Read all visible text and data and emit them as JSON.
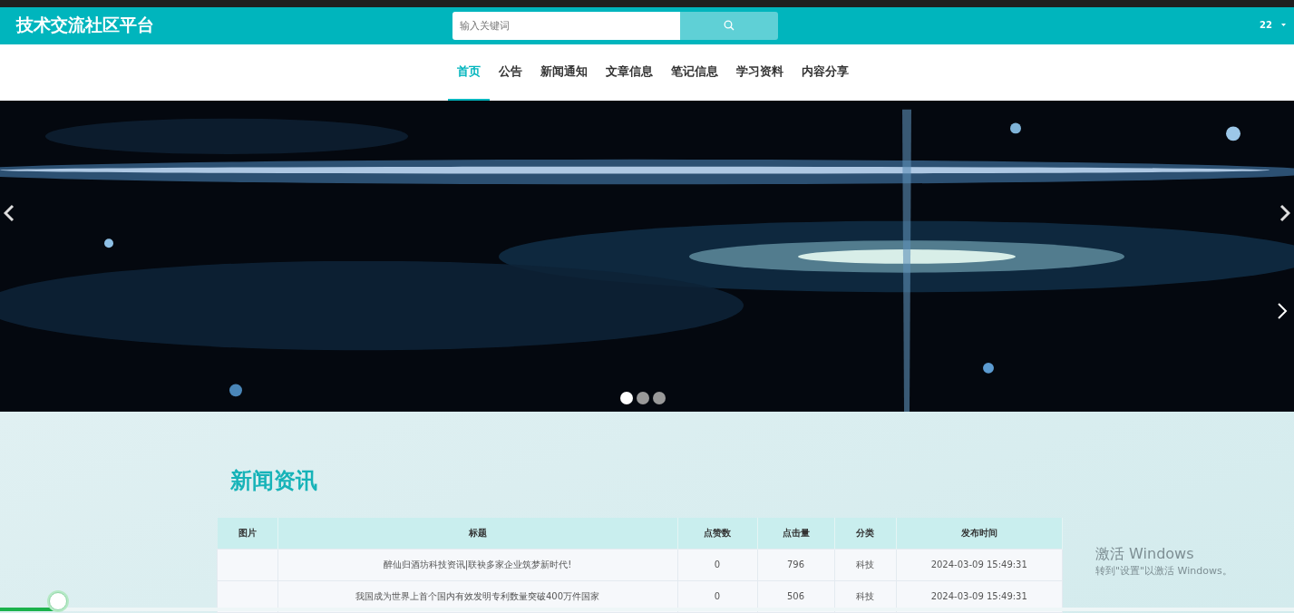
{
  "header": {
    "title": "技术交流社区平台",
    "search": {
      "placeholder": "输入关键词"
    },
    "user": "22"
  },
  "nav": [
    {
      "label": "首页",
      "selected": true
    },
    {
      "label": "公告",
      "selected": false
    },
    {
      "label": "新闻通知",
      "selected": false
    },
    {
      "label": "文章信息",
      "selected": false
    },
    {
      "label": "笔记信息",
      "selected": false
    },
    {
      "label": "学习资料",
      "selected": false
    },
    {
      "label": "内容分享",
      "selected": false
    }
  ],
  "banner": {
    "kind": "picture",
    "dots": [
      {
        "selected": true
      },
      {
        "selected": false
      },
      {
        "selected": false
      }
    ]
  },
  "news": {
    "heading": "新闻资讯",
    "columns": [
      "图片",
      "标题",
      "点赞数",
      "点击量",
      "分类",
      "发布时间"
    ],
    "rows": [
      {
        "title": "醉仙归酒坊科技资讯|联袂多家企业筑梦新时代!",
        "likes": "0",
        "clicks": "796",
        "category": "科技",
        "time": "2024-03-09 15:49:31"
      },
      {
        "title": "我国成为世界上首个国内有效发明专利数量突破400万件国家",
        "likes": "0",
        "clicks": "506",
        "category": "科技",
        "time": "2024-03-09 15:49:31"
      }
    ]
  },
  "activation": {
    "title": "激活 Windows",
    "hint": "转到\"设置\"以激活 Windows。"
  },
  "slider": {
    "level": 0.045
  }
}
